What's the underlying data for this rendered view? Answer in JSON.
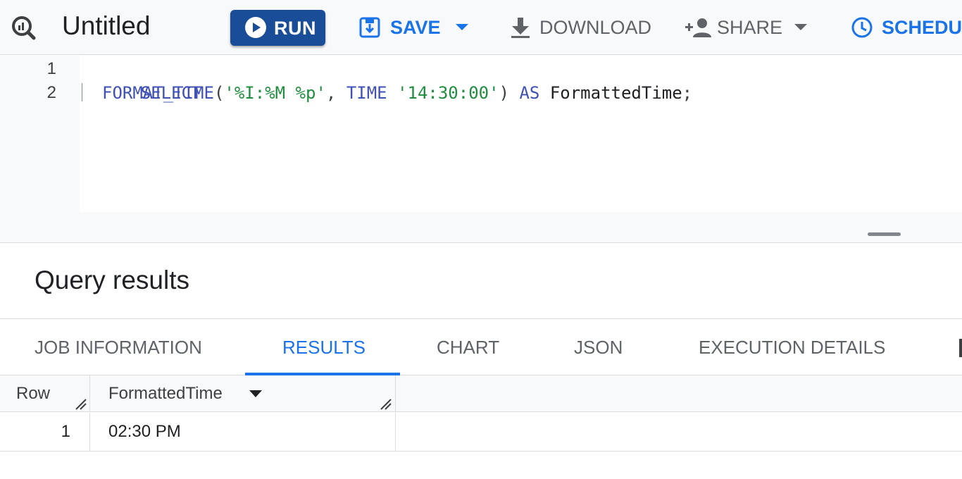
{
  "toolbar": {
    "title": "Untitled",
    "run_label": "RUN",
    "save_label": "SAVE",
    "download_label": "DOWNLOAD",
    "share_label": "SHARE",
    "schedule_label": "SCHEDULE",
    "accent_color": "#1a73e8",
    "run_button_color": "#1a4d98",
    "icons": [
      "query-icon",
      "play-icon",
      "save-icon",
      "chevron-down-icon",
      "download-icon",
      "add-person-icon",
      "clock-icon"
    ]
  },
  "editor": {
    "line_numbers": [
      "1",
      "2"
    ],
    "line1": {
      "keyword": "SELECT"
    },
    "line2": {
      "func": "FORMAT_TIME",
      "open_paren": "(",
      "format_string": "'%I:%M %p'",
      "comma": ",",
      "time_keyword": "TIME",
      "time_string": "'14:30:00'",
      "close_paren": ")",
      "as_keyword": "AS",
      "alias": "FormattedTime",
      "semicolon": ";"
    }
  },
  "results": {
    "header": "Query results",
    "tabs": [
      {
        "label": "JOB INFORMATION",
        "active": false
      },
      {
        "label": "RESULTS",
        "active": true
      },
      {
        "label": "CHART",
        "active": false
      },
      {
        "label": "JSON",
        "active": false
      },
      {
        "label": "EXECUTION DETAILS",
        "active": false
      }
    ],
    "table": {
      "columns": [
        "Row",
        "FormattedTime"
      ],
      "rows": [
        {
          "row": "1",
          "FormattedTime": "02:30 PM"
        }
      ]
    }
  }
}
